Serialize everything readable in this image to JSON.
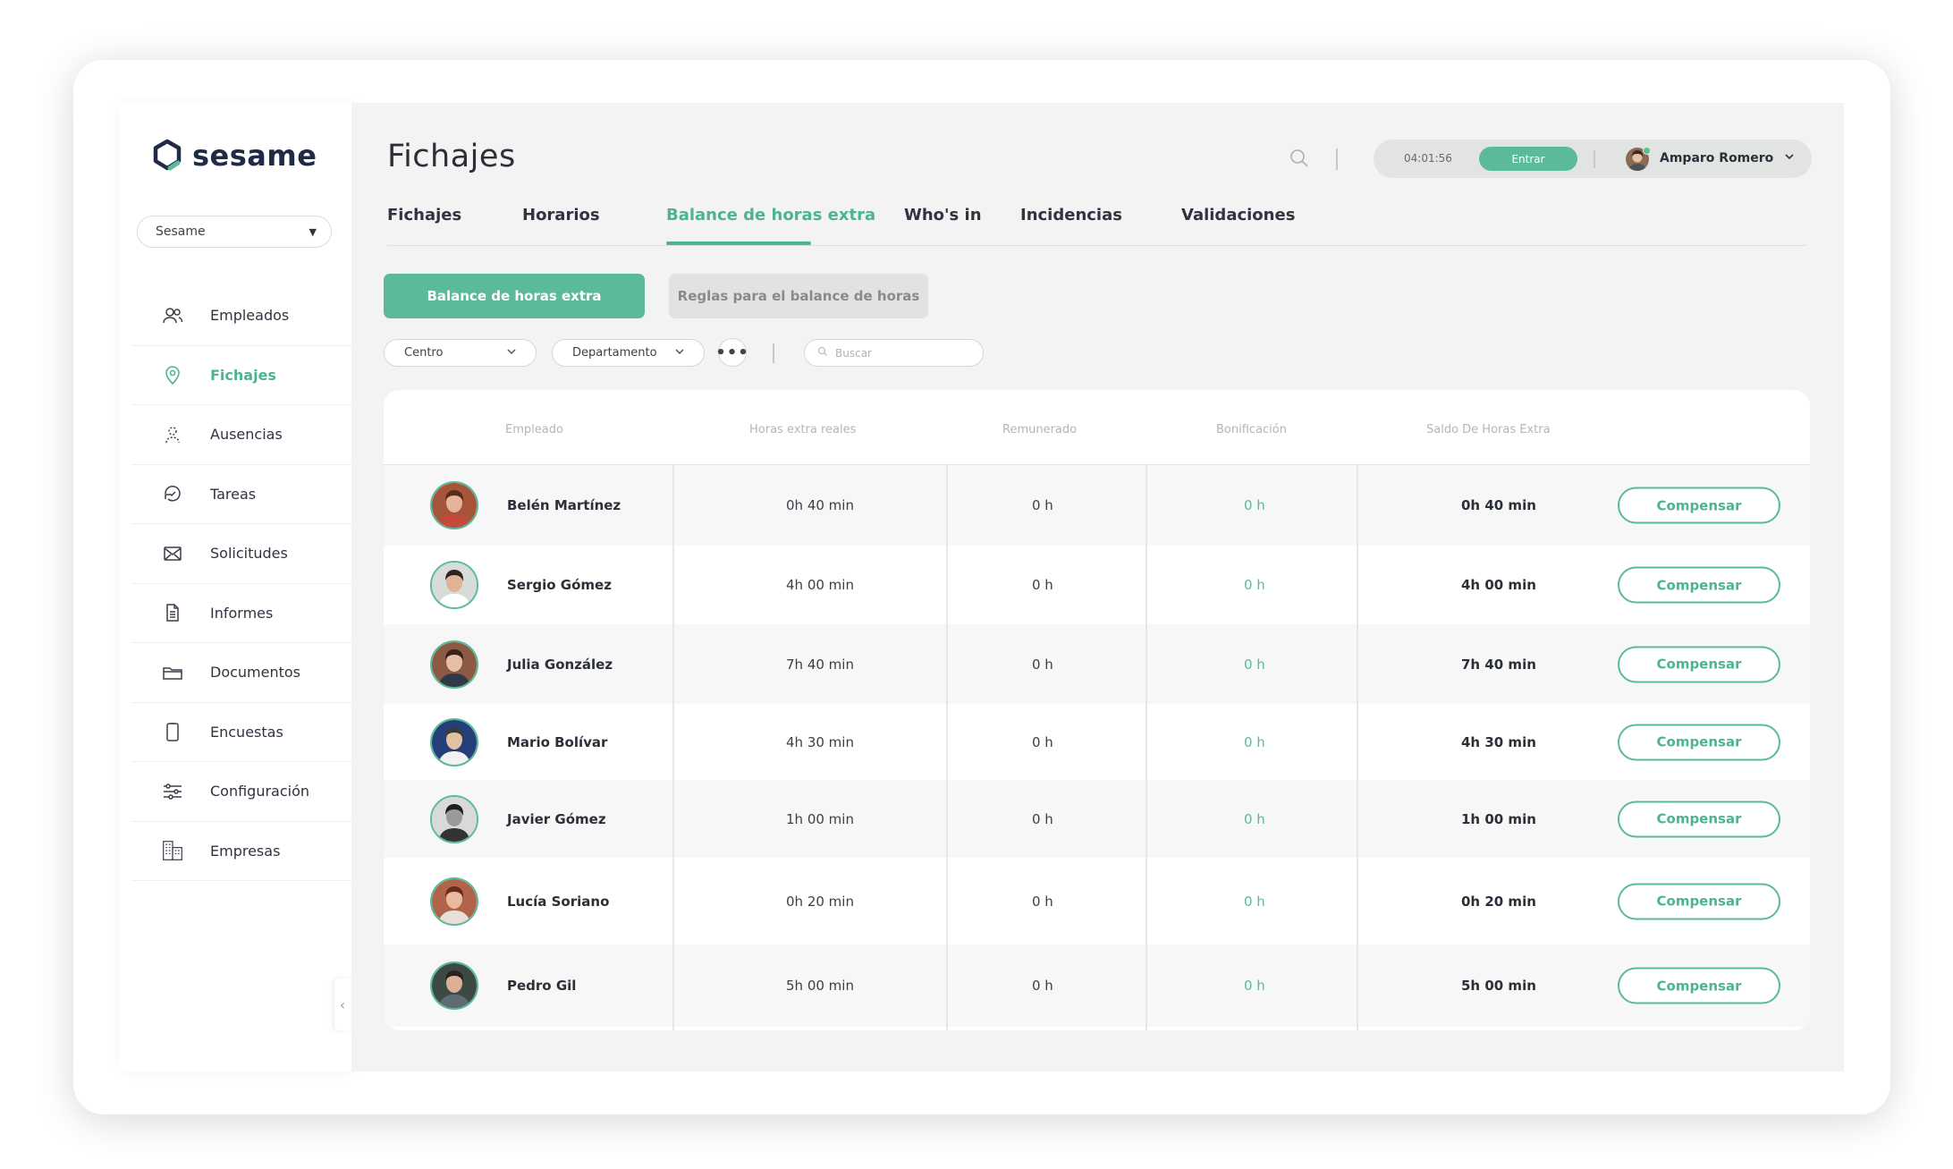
{
  "app": {
    "logo_text": "sesame",
    "company_select": "Sesame"
  },
  "nav": [
    {
      "label": "Empleados",
      "icon": "users-icon",
      "active": false
    },
    {
      "label": "Fichajes",
      "icon": "location-pin-icon",
      "active": true
    },
    {
      "label": "Ausencias",
      "icon": "person-dashed-icon",
      "active": false
    },
    {
      "label": "Tareas",
      "icon": "tasks-icon",
      "active": false
    },
    {
      "label": "Solicitudes",
      "icon": "envelope-icon",
      "active": false
    },
    {
      "label": "Informes",
      "icon": "document-icon",
      "active": false
    },
    {
      "label": "Documentos",
      "icon": "folder-icon",
      "active": false
    },
    {
      "label": "Encuestas",
      "icon": "clipboard-icon",
      "active": false
    },
    {
      "label": "Configuración",
      "icon": "sliders-icon",
      "active": false
    },
    {
      "label": "Empresas",
      "icon": "building-icon",
      "active": false
    }
  ],
  "header": {
    "title": "Fichajes",
    "clock_time": "04:01:56",
    "entrar_label": "Entrar",
    "user_name": "Amparo Romero"
  },
  "tabs": [
    {
      "label": "Fichajes",
      "active": false
    },
    {
      "label": "Horarios",
      "active": false
    },
    {
      "label": "Balance de horas extra",
      "active": true
    },
    {
      "label": "Who's in",
      "active": false
    },
    {
      "label": "Incidencias",
      "active": false
    },
    {
      "label": "Validaciones",
      "active": false
    }
  ],
  "sub_buttons": {
    "primary": "Balance de horas extra",
    "secondary": "Reglas para el balance de horas"
  },
  "filters": {
    "centro": "Centro",
    "departamento": "Departamento",
    "search_placeholder": "Buscar"
  },
  "table": {
    "headers": {
      "empleado": "Empleado",
      "horas_reales": "Horas extra reales",
      "remunerado": "Remunerado",
      "bonificacion": "Bonificación",
      "saldo": "Saldo De Horas Extra"
    },
    "action_label": "Compensar",
    "rows": [
      {
        "name": "Belén Martínez",
        "real": "0h 40 min",
        "remunerado": "0 h",
        "bonificacion": "0 h",
        "saldo": "0h 40 min"
      },
      {
        "name": "Sergio Gómez",
        "real": "4h 00 min",
        "remunerado": "0 h",
        "bonificacion": "0 h",
        "saldo": "4h 00 min"
      },
      {
        "name": "Julia González",
        "real": "7h 40 min",
        "remunerado": "0 h",
        "bonificacion": "0 h",
        "saldo": "7h 40 min"
      },
      {
        "name": "Mario Bolívar",
        "real": "4h 30 min",
        "remunerado": "0 h",
        "bonificacion": "0 h",
        "saldo": "4h 30 min"
      },
      {
        "name": "Javier Gómez",
        "real": "1h 00 min",
        "remunerado": "0 h",
        "bonificacion": "0 h",
        "saldo": "1h 00 min"
      },
      {
        "name": "Lucía Soriano",
        "real": "0h 20 min",
        "remunerado": "0 h",
        "bonificacion": "0 h",
        "saldo": "0h 20 min"
      },
      {
        "name": "Pedro Gil",
        "real": "5h 00 min",
        "remunerado": "0 h",
        "bonificacion": "0 h",
        "saldo": "5h 00 min"
      }
    ]
  },
  "colors": {
    "accent": "#5bba9a",
    "accent_text": "#4db395",
    "background": "#f3f3f3"
  }
}
